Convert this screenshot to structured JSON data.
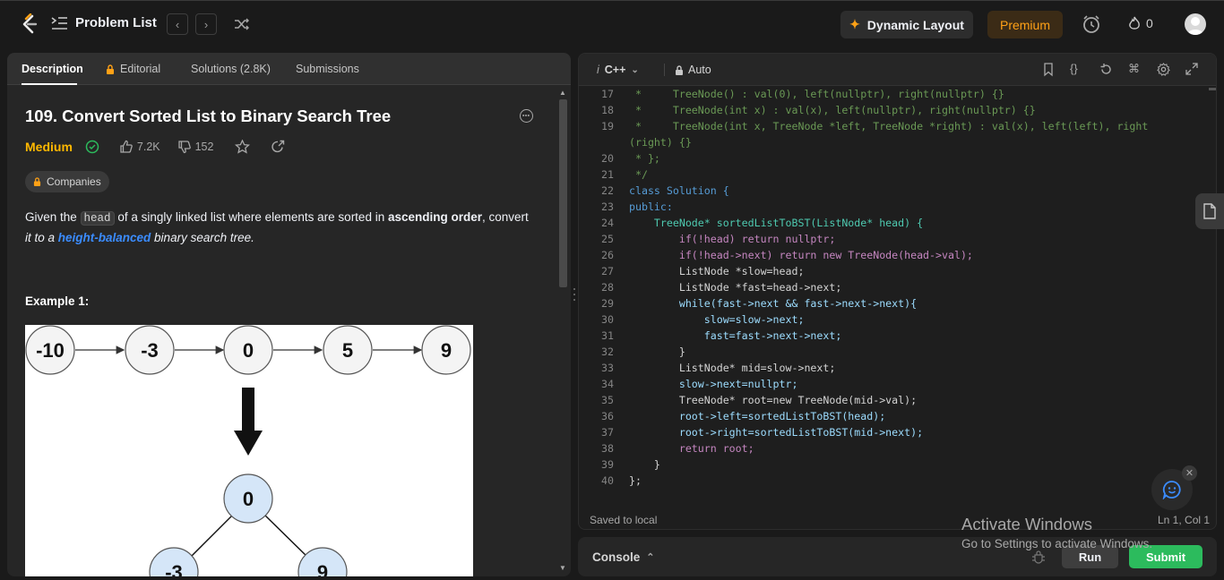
{
  "topbar": {
    "problem_list": "Problem List",
    "dynamic_layout": "Dynamic Layout",
    "premium": "Premium",
    "streak_count": "0"
  },
  "tabs": [
    {
      "label": "Description"
    },
    {
      "label": "Editorial"
    },
    {
      "label": "Solutions (2.8K)"
    },
    {
      "label": "Submissions"
    }
  ],
  "problem": {
    "title": "109. Convert Sorted List to Binary Search Tree",
    "difficulty": "Medium",
    "likes": "7.2K",
    "dislikes": "152",
    "companies": "Companies",
    "desc": {
      "p1": "Given the ",
      "code": "head",
      "p2": " of a singly linked list where elements are sorted in ",
      "bold": "ascending order",
      "p3": ", convert",
      "it1": "it to a ",
      "link": "height-balanced",
      "it2": " binary search tree."
    },
    "example_heading": "Example 1:",
    "diagram": {
      "list": [
        "-10",
        "-3",
        "0",
        "5",
        "9"
      ],
      "root": "0",
      "left": "-3",
      "right": "9"
    }
  },
  "editor": {
    "language": "C++",
    "mode": "Auto",
    "saved": "Saved to local",
    "cursor": "Ln 1, Col 1",
    "lines": [
      {
        "n": "17",
        "t": " *     TreeNode() : val(0), left(nullptr), right(nullptr) {}"
      },
      {
        "n": "18",
        "t": " *     TreeNode(int x) : val(x), left(nullptr), right(nullptr) {}"
      },
      {
        "n": "19",
        "t": " *     TreeNode(int x, TreeNode *left, TreeNode *right) : val(x), left(left), right"
      },
      {
        "n": "",
        "t": "(right) {}"
      },
      {
        "n": "20",
        "t": " * };"
      },
      {
        "n": "21",
        "t": " */"
      },
      {
        "n": "22",
        "t": "class Solution {"
      },
      {
        "n": "23",
        "t": "public:"
      },
      {
        "n": "24",
        "t": "    TreeNode* sortedListToBST(ListNode* head) {"
      },
      {
        "n": "25",
        "t": "        if(!head) return nullptr;"
      },
      {
        "n": "26",
        "t": "        if(!head->next) return new TreeNode(head->val);"
      },
      {
        "n": "27",
        "t": "        ListNode *slow=head;"
      },
      {
        "n": "28",
        "t": "        ListNode *fast=head->next;"
      },
      {
        "n": "29",
        "t": "        while(fast->next && fast->next->next){"
      },
      {
        "n": "30",
        "t": "            slow=slow->next;"
      },
      {
        "n": "31",
        "t": "            fast=fast->next->next;"
      },
      {
        "n": "32",
        "t": "        }"
      },
      {
        "n": "33",
        "t": "        ListNode* mid=slow->next;"
      },
      {
        "n": "34",
        "t": "        slow->next=nullptr;"
      },
      {
        "n": "35",
        "t": "        TreeNode* root=new TreeNode(mid->val);"
      },
      {
        "n": "36",
        "t": "        root->left=sortedListToBST(head);"
      },
      {
        "n": "37",
        "t": "        root->right=sortedListToBST(mid->next);"
      },
      {
        "n": "38",
        "t": "        return root;"
      },
      {
        "n": "39",
        "t": "    }"
      },
      {
        "n": "40",
        "t": "};"
      }
    ]
  },
  "console": {
    "label": "Console",
    "run": "Run",
    "submit": "Submit"
  },
  "watermark": {
    "line1": "Activate Windows",
    "line2": "Go to Settings to activate Windows."
  },
  "colors": {
    "accent_orange": "#ffa116",
    "medium": "#ffb800",
    "submit_green": "#2cbb5d",
    "link_blue": "#3b8cff"
  }
}
